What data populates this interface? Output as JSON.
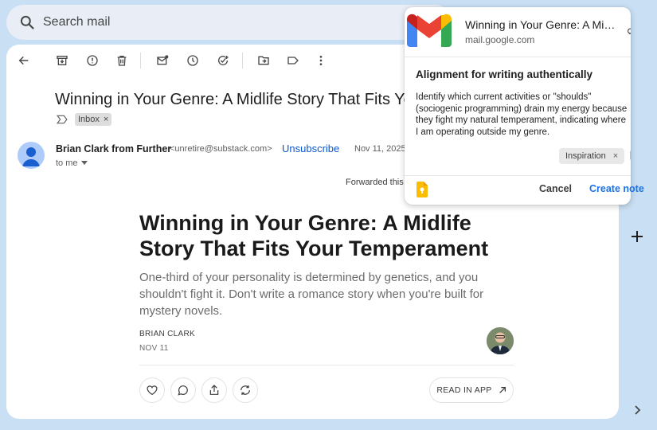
{
  "colors": {
    "background": "#c9dff3",
    "search_bg": "#e9eef6",
    "link_blue": "#0b57d0",
    "accent_blue": "#1a73e8"
  },
  "search": {
    "placeholder": "Search mail",
    "icon": "search-icon"
  },
  "toolbar": {
    "icons": [
      "back-arrow-icon",
      "archive-icon",
      "report-spam-icon",
      "delete-icon",
      "mark-unread-icon",
      "snooze-icon",
      "add-task-icon",
      "move-to-icon",
      "label-icon",
      "more-vert-icon"
    ]
  },
  "email": {
    "subject": "Winning in Your Genre: A Midlife Story That Fits Your",
    "inbox_label": "Inbox",
    "sender_name": "Brian Clark from Further",
    "sender_email": "<unretire@substack.com>",
    "unsubscribe": "Unsubscribe",
    "date": "Nov 11, 2025,",
    "recipient": "to me",
    "forwarded_note": "Forwarded this e"
  },
  "post": {
    "title": "Winning in Your Genre: A Midlife Story That Fits Your Temperament",
    "subtitle": "One-third of your personality is determined by genetics, and you shouldn't fight it. Don't write a romance story when you're built for mystery novels.",
    "author": "BRIAN CLARK",
    "date": "NOV 11",
    "actions": [
      "heart-icon",
      "comment-icon",
      "share-icon",
      "restack-icon"
    ],
    "read_in_app": "READ IN APP"
  },
  "rail": {
    "add_icon": "plus-icon",
    "expand_icon": "chevron-right-icon"
  },
  "popup": {
    "page_title": "Winning in Your Genre: A Midlife Story That Fits Your Temperament",
    "domain": "mail.google.com",
    "note_title": "Alignment for writing authentically",
    "note_body": "Identify which current activities or \"shoulds\" (sociogenic programming) drain my energy because they fight my natural temperament, indicating where I am operating outside my genre.",
    "tag": "Inspiration",
    "cancel": "Cancel",
    "create": "Create note"
  }
}
